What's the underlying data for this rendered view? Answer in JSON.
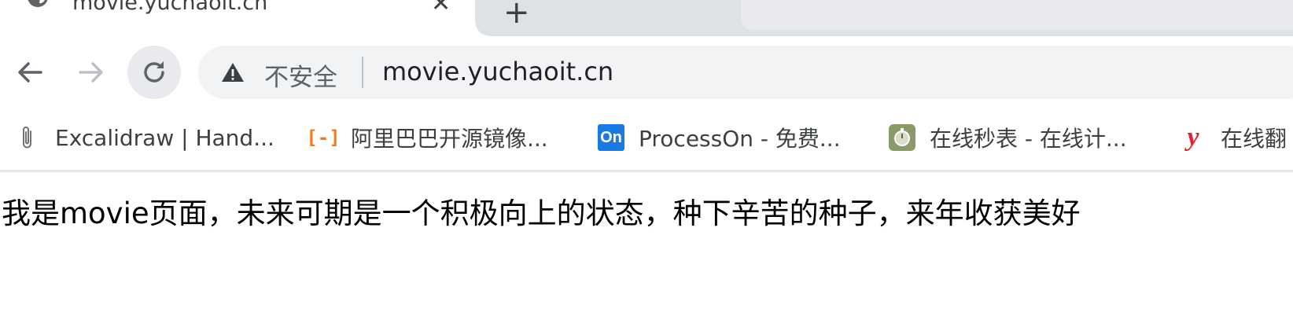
{
  "tab": {
    "title": "movie.yuchaoit.cn",
    "close_glyph": "✕",
    "new_tab_glyph": "+",
    "icon": "globe-icon"
  },
  "toolbar": {
    "back_icon": "arrow-left-icon",
    "forward_icon": "arrow-right-icon",
    "reload_icon": "reload-icon",
    "security_icon": "warning-triangle-icon",
    "security_label": "不安全",
    "url": "movie.yuchaoit.cn"
  },
  "bookmarks": [
    {
      "label": "Excalidraw | Hand...",
      "icon": "paperclip-icon"
    },
    {
      "label": "阿里巴巴开源镜像...",
      "icon": "aliyun-icon",
      "icon_text": "[-]"
    },
    {
      "label": "ProcessOn - 免费...",
      "icon": "processon-icon",
      "icon_text": "On"
    },
    {
      "label": "在线秒表 - 在线计...",
      "icon": "stopwatch-icon"
    },
    {
      "label": "在线翻",
      "icon": "youdao-icon",
      "icon_text": "y"
    }
  ],
  "page": {
    "text": "我是movie页面，未来可期是一个积极向上的状态，种下辛苦的种子，来年收获美好"
  },
  "colors": {
    "tabstrip_bg": "#dee1e6",
    "omnibox_bg": "#f1f3f4",
    "processon_blue": "#1a7ae0",
    "aliyun_orange": "#f47a20",
    "youdao_red": "#e0242b"
  }
}
